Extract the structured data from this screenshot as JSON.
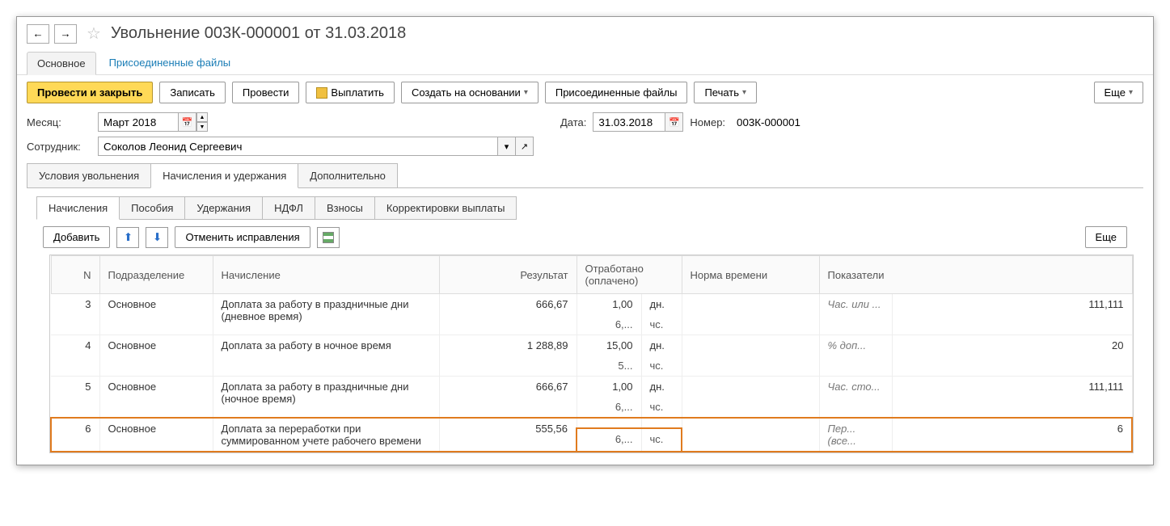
{
  "title": "Увольнение 003К-000001 от 31.03.2018",
  "nav_tabs": {
    "main": "Основное",
    "files": "Присоединенные файлы"
  },
  "toolbar": {
    "post_close": "Провести и закрыть",
    "save": "Записать",
    "post": "Провести",
    "pay": "Выплатить",
    "create_based": "Создать на основании",
    "attached": "Присоединенные файлы",
    "print": "Печать",
    "more": "Еще"
  },
  "form": {
    "month_label": "Месяц:",
    "month_value": "Март 2018",
    "date_label": "Дата:",
    "date_value": "31.03.2018",
    "number_label": "Номер:",
    "number_value": "003К-000001",
    "employee_label": "Сотрудник:",
    "employee_value": "Соколов Леонид Сергеевич"
  },
  "inner_tabs": {
    "conditions": "Условия увольнения",
    "accruals": "Начисления и удержания",
    "additional": "Дополнительно"
  },
  "sub_tabs": {
    "accruals": "Начисления",
    "benefits": "Пособия",
    "deductions": "Удержания",
    "ndfl": "НДФЛ",
    "contributions": "Взносы",
    "corrections": "Корректировки выплаты"
  },
  "table_toolbar": {
    "add": "Добавить",
    "cancel_fix": "Отменить исправления",
    "more": "Еще"
  },
  "columns": {
    "n": "N",
    "dept": "Подразделение",
    "accrual": "Начисление",
    "result": "Результат",
    "worked": "Отработано (оплачено)",
    "norm": "Норма времени",
    "indicators": "Показатели"
  },
  "rows": [
    {
      "n": "3",
      "dept": "Основное",
      "accrual": "Доплата за работу в праздничные дни (дневное время)",
      "result": "666,67",
      "worked1": "1,00",
      "unit1": "дн.",
      "worked2": "6,...",
      "unit2": "чс.",
      "ind_label": "Час. или ...",
      "ind_val": "111,111"
    },
    {
      "n": "4",
      "dept": "Основное",
      "accrual": "Доплата за работу в ночное время",
      "result": "1 288,89",
      "worked1": "15,00",
      "unit1": "дн.",
      "worked2": "5...",
      "unit2": "чс.",
      "ind_label": "% доп...",
      "ind_val": "20"
    },
    {
      "n": "5",
      "dept": "Основное",
      "accrual": "Доплата за работу в праздничные дни (ночное время)",
      "result": "666,67",
      "worked1": "1,00",
      "unit1": "дн.",
      "worked2": "6,...",
      "unit2": "чс.",
      "ind_label": "Час. сто...",
      "ind_val": "111,111"
    },
    {
      "n": "6",
      "dept": "Основное",
      "accrual": "Доплата за переработки при суммированном учете рабочего времени",
      "result": "555,56",
      "worked1": "",
      "unit1": "",
      "worked2": "6,...",
      "unit2": "чс.",
      "ind_label": "Пер... (все...",
      "ind_val": "6",
      "highlight": true
    }
  ]
}
